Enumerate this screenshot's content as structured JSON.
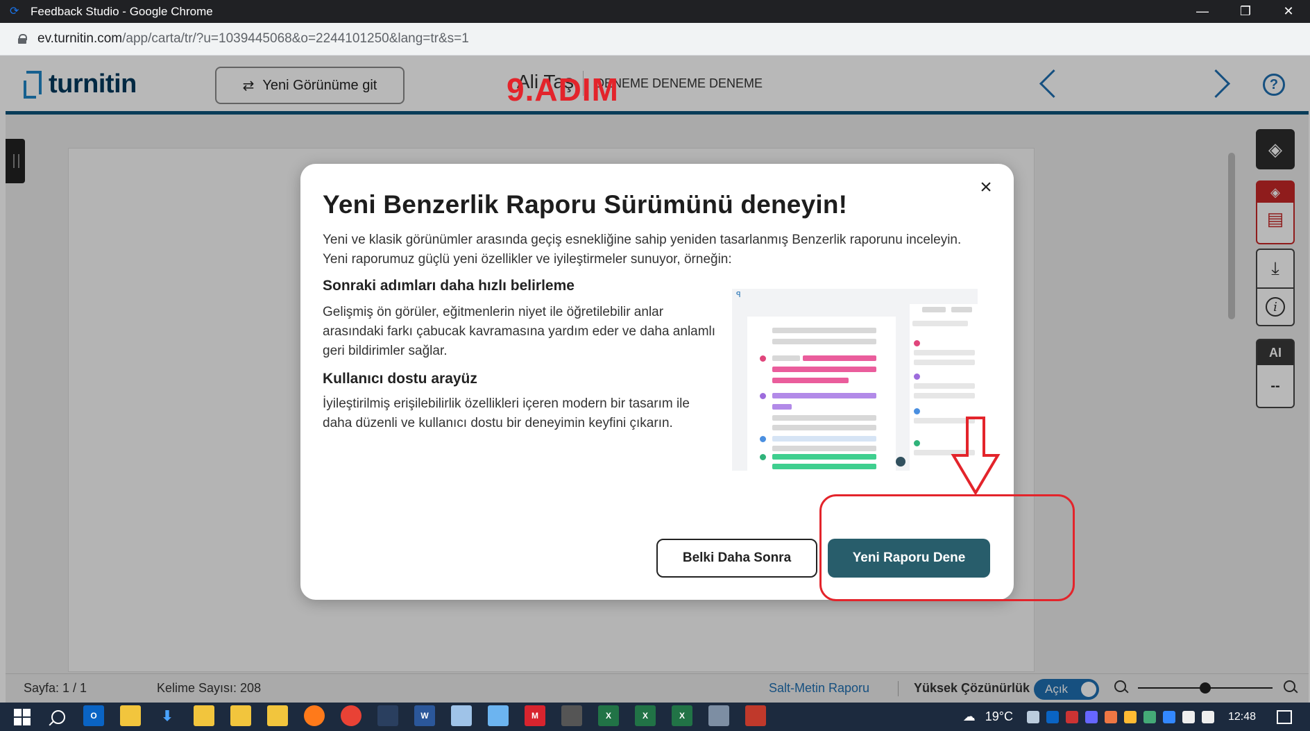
{
  "browser": {
    "window_title": "Feedback Studio - Google Chrome",
    "url_host": "ev.turnitin.com",
    "url_path": "/app/carta/tr/?u=1039445068&o=2244101250&lang=tr&s=1"
  },
  "header": {
    "logo_text": "turnitin",
    "new_view_label": "Yeni Görünüme git",
    "student_name": "Ali Taş",
    "assignment_title": "DENEME DENEME DENEME"
  },
  "annotation": {
    "step_label": "9.ADIM",
    "accent_color": "#e3242b"
  },
  "modal": {
    "title": "Yeni Benzerlik Raporu Sürümünü deneyin!",
    "intro": "Yeni ve klasik görünümler arasında geçiş esnekliğine sahip yeniden tasarlanmış Benzerlik raporunu inceleyin. Yeni raporumuz güçlü yeni özellikler ve iyileştirmeler sunuyor, örneğin:",
    "section1_title": "Sonraki adımları daha hızlı belirleme",
    "section1_text": "Gelişmiş ön görüler, eğitmenlerin niyet ile öğretilebilir anlar arasındaki farkı çabucak kavramasına yardım eder ve daha anlamlı geri bildirimler sağlar.",
    "section2_title": "Kullanıcı dostu arayüz",
    "section2_text": "İyileştirilmiş erişilebilirlik özellikleri içeren modern bir tasarım ile daha düzenli ve kullanıcı dostu bir deneyimin keyfini çıkarın.",
    "close_symbol": "×",
    "later_label": "Belki Daha Sonra",
    "try_label": "Yeni Raporu Dene",
    "try_color": "#285d6b"
  },
  "tools": {
    "ai_label": "AI",
    "ai_value": "--"
  },
  "footer": {
    "page_label": "Sayfa: 1 / 1",
    "word_count_label": "Kelime Sayısı: 208",
    "text_only_label": "Salt-Metin Raporu",
    "hires_label": "Yüksek Çözünürlük",
    "toggle_label": "Açık",
    "zoom_level": 0.5
  },
  "taskbar": {
    "temperature": "19°C",
    "time": "12:48"
  }
}
